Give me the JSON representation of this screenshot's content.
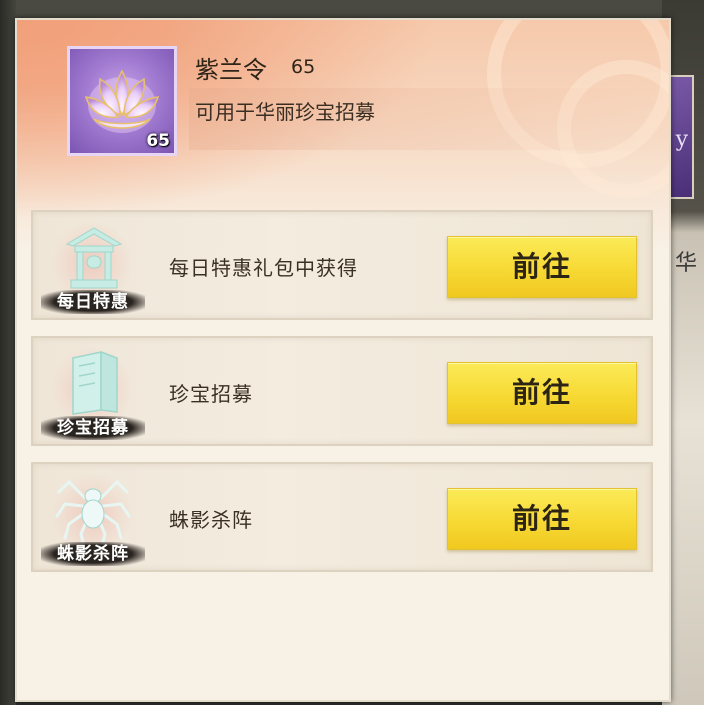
{
  "item": {
    "name": "紫兰令",
    "level": "65",
    "icon_count": "65",
    "description": "可用于华丽珍宝招募",
    "icon": "lotus-icon"
  },
  "background": {
    "side_text": "华",
    "card_glyph": "y"
  },
  "sources": [
    {
      "tag": "每日特惠",
      "text": "每日特惠礼包中获得",
      "button": "前往",
      "icon": "pavilion-icon"
    },
    {
      "tag": "珍宝招募",
      "text": "珍宝招募",
      "button": "前往",
      "icon": "scroll-book-icon"
    },
    {
      "tag": "蛛影杀阵",
      "text": "蛛影杀阵",
      "button": "前往",
      "icon": "spider-icon"
    }
  ],
  "colors": {
    "button": "#f7d934",
    "item_frame": "#9f78cf",
    "header_accent": "#f1a07a"
  }
}
